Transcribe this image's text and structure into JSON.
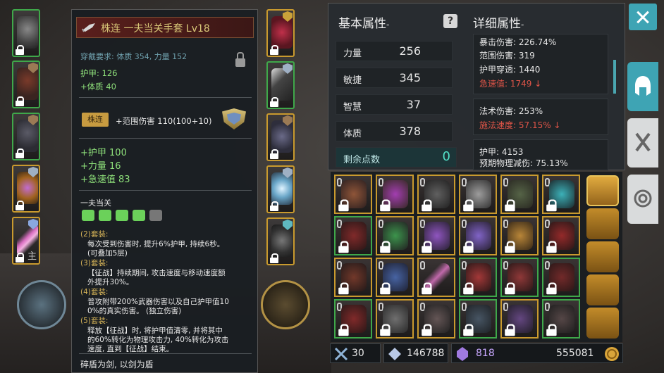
{
  "tooltip": {
    "item_name": "株连  一夫当关手套  Lv18",
    "requirement": "穿戴要求:  体质 354, 力量 152",
    "base_stats": [
      "护甲:  126",
      "+体质 40"
    ],
    "tag": "株连",
    "special_stat": "+范围伤害 110(100+10)",
    "bonus_stats": [
      "+护甲  100",
      "+力量  16",
      "+急速值  83"
    ],
    "set_name": "一夫当关",
    "set_bonuses": [
      {
        "header": "(2)套装:",
        "lines": [
          "每次受到伤害时, 提升6%护甲, 持续6秒。",
          "(可叠加5层)"
        ]
      },
      {
        "header": "(3)套装:",
        "lines": [
          "【征战】持续期间, 攻击速度与移动速度额",
          "外提升30%。"
        ]
      },
      {
        "header": "(4)套装:",
        "lines": [
          "普攻附带200%武器伤害以及自己护甲值10",
          "0%的真实伤害。 (独立伤害)"
        ]
      },
      {
        "header": "(5)套装:",
        "lines": [
          "释放【征战】时, 将护甲值清零, 并将其中",
          "的60%转化为物理攻击力, 40%转化为攻击",
          "速度, 直到【征战】结束。"
        ]
      }
    ],
    "flavor": "碎盾为剑, 以剑为盾"
  },
  "left_slot_label": "主",
  "attributes": {
    "basic_header": "基本属性",
    "basic_header_suffix": "-",
    "detail_header": "详细属性",
    "detail_header_suffix": "-",
    "help_label": "?",
    "basic": [
      {
        "name": "力量",
        "value": "256"
      },
      {
        "name": "敏捷",
        "value": "345"
      },
      {
        "name": "智慧",
        "value": "37"
      },
      {
        "name": "体质",
        "value": "378"
      }
    ],
    "remaining_label": "剩余点数",
    "remaining_value": "0",
    "detail_box1": [
      {
        "text": "暴击伤害:  226.74%",
        "red": false
      },
      {
        "text": "范围伤害:  319",
        "red": false
      },
      {
        "text": "护甲穿透:  1440",
        "red": false
      },
      {
        "text": "急速值:  1749 ↓",
        "red": true
      }
    ],
    "detail_box2": [
      {
        "text": "法术伤害:  253%",
        "red": false
      },
      {
        "text": "施法速度:  57.15% ↓",
        "red": true
      }
    ],
    "detail_box3": [
      {
        "text": "护甲:  4153",
        "red": false
      },
      {
        "text": "预期物理减伤:  75.13%",
        "red": false
      }
    ]
  },
  "currency": {
    "swords": "30",
    "gems": "146788",
    "crystals": "818",
    "gold": "555081"
  },
  "colors": {
    "accent_teal": "#3ea4b4",
    "gold_border": "#c99a2e",
    "green_border": "#3fa84a",
    "stat_green": "#8ee07a",
    "warn_red": "#e05548"
  },
  "icons": {
    "close": "close-icon",
    "equipment_tab": "helmet-icon",
    "skill_tab": "crossed-swords-icon",
    "settings_tab": "target-icon",
    "lock": "lock-icon"
  }
}
